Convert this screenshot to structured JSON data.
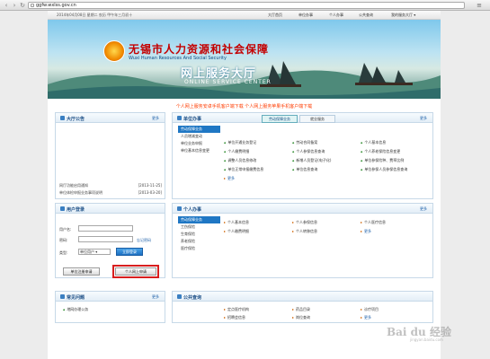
{
  "browser": {
    "url": "ggfw.wxlss.gov.cn"
  },
  "topnav": {
    "date": "2014年04月08日 星期二 农历 甲午年三月初十",
    "links": [
      "大厅首页",
      "单位办事",
      "个人办事",
      "公共查询",
      "我的服务大厅 ▾"
    ]
  },
  "banner": {
    "title_cn": "无锡市人力资源和社会保障",
    "title_en": "Wuxi Human Resources And Social Security",
    "title_cn2": "网上服务大厅",
    "title_en2": "ONLINE SERVICE CENTER"
  },
  "marquee": "个人网上服务安卓手机客户端下载  个人网上服务苹果手机客户端下载",
  "notice": {
    "title": "大厅公告",
    "more": "更多",
    "items": [
      {
        "text": "网厅功能启用通知",
        "date": "[2013-11-25]"
      },
      {
        "text": "单位体检申报业务事项说明",
        "date": "[2013-03-20]"
      }
    ]
  },
  "login": {
    "title": "用户登录",
    "user_label": "用户名:",
    "password_label": "密码:",
    "forgot": "忘记密码",
    "type_label": "类型:",
    "type_value": "单位用户 ▾",
    "login_button": "立即登录",
    "unit_register": "单位注册申请",
    "personal_register": "个人网上申请"
  },
  "faq": {
    "title": "常见问题",
    "more": "更多",
    "item": "地网办理公务"
  },
  "unit_service": {
    "title": "单位办事",
    "more": "更多",
    "tabs": [
      "劳动保障业务",
      "就业服务"
    ],
    "side": [
      "劳动保障业务",
      "人员增减变动",
      "单位业务申报",
      "单位基本信息变更"
    ],
    "links": [
      "单位开通业务登记",
      "劳动合同备案",
      "个人基本信息",
      "个人缴费明细",
      "个人参保信息查询",
      "个人养老保险信息变更",
      "调整人员信息修改",
      "新增人员登记(电子化)",
      "单位参保险种、费率比例",
      "单位正常申报缴费信息",
      "单位信息查询",
      "单位参保人员参保信息查询",
      "更多"
    ]
  },
  "personal_service": {
    "title": "个人办事",
    "more": "更多",
    "side": [
      "劳动保障业务",
      "工伤保险",
      "生育保险",
      "养老保险",
      "医疗保险"
    ],
    "links": [
      "个人基本信息",
      "个人参保信息",
      "个人医疗信息",
      "个人缴费明细",
      "个人转移信息",
      "更多"
    ]
  },
  "public_query": {
    "title": "公共查询",
    "links": [
      "定点医疗机构",
      "药品目录",
      "诊疗项目",
      "招聘会信息",
      "岗位查询",
      "更多"
    ]
  },
  "watermark": {
    "logo": "Bai du 经验",
    "sub": "jingyan.baidu.com"
  }
}
